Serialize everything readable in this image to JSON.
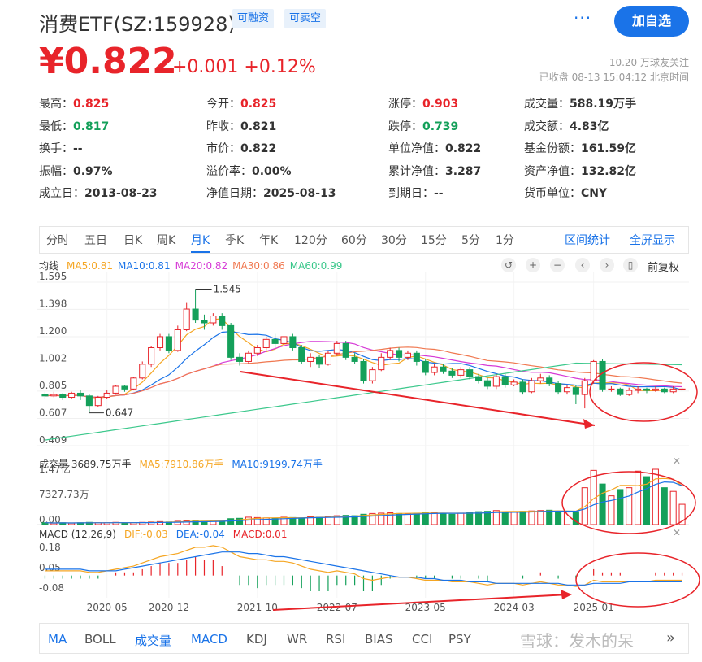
{
  "header": {
    "title": "消费ETF(SZ:159928)",
    "tags": [
      "可融资",
      "可卖空"
    ],
    "more_icon": "···",
    "follow_button": "加自选",
    "price": "¥0.822",
    "change": "+0.001 +0.12%",
    "followers": "10.20 万球友关注",
    "status_time": "已收盘 08-13 15:04:12 北京时间"
  },
  "quote": {
    "col1": [
      {
        "label": "最高：",
        "value": "0.825",
        "color": "red"
      },
      {
        "label": "最低：",
        "value": "0.817",
        "color": "green"
      },
      {
        "label": "换手：",
        "value": "--",
        "color": ""
      },
      {
        "label": "振幅：",
        "value": "0.97%",
        "color": ""
      },
      {
        "label": "成立日：",
        "value": "2013-08-23",
        "color": ""
      }
    ],
    "col2": [
      {
        "label": "今开：",
        "value": "0.825",
        "color": "red"
      },
      {
        "label": "昨收：",
        "value": "0.821",
        "color": ""
      },
      {
        "label": "市价：",
        "value": "0.822",
        "color": ""
      },
      {
        "label": "溢价率：",
        "value": "0.00%",
        "color": ""
      },
      {
        "label": "净值日期：",
        "value": "2025-08-13",
        "color": ""
      }
    ],
    "col3": [
      {
        "label": "涨停：",
        "value": "0.903",
        "color": "red"
      },
      {
        "label": "跌停：",
        "value": "0.739",
        "color": "green"
      },
      {
        "label": "单位净值：",
        "value": "0.822",
        "color": ""
      },
      {
        "label": "累计净值：",
        "value": "3.287",
        "color": ""
      },
      {
        "label": "到期日：",
        "value": "--",
        "color": ""
      }
    ],
    "col4": [
      {
        "label": "成交量：",
        "value": "588.19万手",
        "color": ""
      },
      {
        "label": "成交额：",
        "value": "4.83亿",
        "color": ""
      },
      {
        "label": "基金份额：",
        "value": "161.59亿",
        "color": ""
      },
      {
        "label": "资产净值：",
        "value": "132.82亿",
        "color": ""
      },
      {
        "label": "货币单位：",
        "value": "CNY",
        "color": ""
      }
    ]
  },
  "period_tabs": [
    "分时",
    "五日",
    "日K",
    "周K",
    "月K",
    "季K",
    "年K",
    "120分",
    "60分",
    "30分",
    "15分",
    "5分",
    "1分"
  ],
  "active_period": "月K",
  "tab_links": [
    "区间统计",
    "全屏显示"
  ],
  "ma_legend": {
    "label": "均线",
    "items": [
      {
        "text": "MA5:0.81",
        "color": "#f5a623"
      },
      {
        "text": "MA10:0.81",
        "color": "#1a73e8"
      },
      {
        "text": "MA20:0.82",
        "color": "#d63ad6"
      },
      {
        "text": "MA30:0.86",
        "color": "#f07850"
      },
      {
        "text": "MA60:0.99",
        "color": "#3cc88c"
      }
    ],
    "adjust": "前复权"
  },
  "controls": [
    "↺",
    "+",
    "−",
    "‹",
    "›",
    "▯"
  ],
  "vol_legend": {
    "label": "成交量 3689.75万手",
    "items": [
      {
        "text": "MA5:7910.86万手",
        "color": "#f5a623"
      },
      {
        "text": "MA10:9199.74万手",
        "color": "#1a73e8"
      }
    ]
  },
  "macd_legend": {
    "label": "MACD (12,26,9)",
    "items": [
      {
        "text": "DIF:-0.03",
        "color": "#f5a623"
      },
      {
        "text": "DEA:-0.04",
        "color": "#1a73e8"
      },
      {
        "text": "MACD:0.01",
        "color": "#e8242a"
      }
    ]
  },
  "indicators": [
    "MA",
    "BOLL",
    "成交量",
    "MACD",
    "KDJ",
    "WR",
    "RSI",
    "BIAS",
    "CCI",
    "PSY"
  ],
  "active_indicators": [
    "MA",
    "成交量",
    "MACD"
  ],
  "watermark": "雪球：发木的呆",
  "chart_data": {
    "type": "candlestick",
    "price_ticks": [
      "1.595",
      "1.398",
      "1.200",
      "1.002",
      "0.805",
      "0.607",
      "0.409"
    ],
    "price_ylim": [
      0.409,
      1.595
    ],
    "max_label": "1.545",
    "min_label": "0.647",
    "vol_ticks": [
      "1.47亿",
      "7327.73万",
      "0.00"
    ],
    "macd_ticks": [
      "0.18",
      "0.05",
      "-0.08"
    ],
    "x_ticks": [
      "2020-05",
      "2020-12",
      "2021-10",
      "2022-07",
      "2023-05",
      "2024-03",
      "2025-01"
    ],
    "candles": [
      [
        0.78,
        0.77,
        0.8,
        0.75
      ],
      [
        0.77,
        0.78,
        0.8,
        0.76
      ],
      [
        0.78,
        0.76,
        0.79,
        0.74
      ],
      [
        0.76,
        0.79,
        0.8,
        0.75
      ],
      [
        0.79,
        0.77,
        0.81,
        0.74
      ],
      [
        0.77,
        0.7,
        0.78,
        0.65
      ],
      [
        0.7,
        0.76,
        0.77,
        0.69
      ],
      [
        0.76,
        0.79,
        0.81,
        0.75
      ],
      [
        0.79,
        0.84,
        0.85,
        0.78
      ],
      [
        0.84,
        0.82,
        0.85,
        0.8
      ],
      [
        0.82,
        0.9,
        0.91,
        0.81
      ],
      [
        0.9,
        1.0,
        1.02,
        0.89
      ],
      [
        1.0,
        1.12,
        1.13,
        0.98
      ],
      [
        1.12,
        1.2,
        1.22,
        1.1
      ],
      [
        1.2,
        1.1,
        1.22,
        1.08
      ],
      [
        1.1,
        1.25,
        1.28,
        1.09
      ],
      [
        1.25,
        1.4,
        1.45,
        1.24
      ],
      [
        1.4,
        1.32,
        1.545,
        1.3
      ],
      [
        1.32,
        1.3,
        1.36,
        1.25
      ],
      [
        1.3,
        1.35,
        1.37,
        1.28
      ],
      [
        1.35,
        1.28,
        1.37,
        1.25
      ],
      [
        1.28,
        1.05,
        1.3,
        1.03
      ],
      [
        1.05,
        1.02,
        1.08,
        0.99
      ],
      [
        1.02,
        1.08,
        1.1,
        1.0
      ],
      [
        1.08,
        1.12,
        1.14,
        1.06
      ],
      [
        1.12,
        1.18,
        1.2,
        1.1
      ],
      [
        1.18,
        1.15,
        1.22,
        1.12
      ],
      [
        1.15,
        1.2,
        1.24,
        1.13
      ],
      [
        1.2,
        1.12,
        1.22,
        1.1
      ],
      [
        1.12,
        1.02,
        1.14,
        1.0
      ],
      [
        1.02,
        1.05,
        1.08,
        0.98
      ],
      [
        1.05,
        1.0,
        1.07,
        0.97
      ],
      [
        1.0,
        1.08,
        1.1,
        0.99
      ],
      [
        1.08,
        1.15,
        1.17,
        1.06
      ],
      [
        1.15,
        1.05,
        1.17,
        1.03
      ],
      [
        1.05,
        1.02,
        1.08,
        1.0
      ],
      [
        1.02,
        0.88,
        1.04,
        0.86
      ],
      [
        0.88,
        0.96,
        0.98,
        0.86
      ],
      [
        0.96,
        1.05,
        1.08,
        0.95
      ],
      [
        1.05,
        1.1,
        1.12,
        1.03
      ],
      [
        1.1,
        1.05,
        1.12,
        1.02
      ],
      [
        1.05,
        1.08,
        1.1,
        1.03
      ],
      [
        1.08,
        1.02,
        1.1,
        0.99
      ],
      [
        1.02,
        0.94,
        1.04,
        0.92
      ],
      [
        0.94,
        0.98,
        1.0,
        0.92
      ],
      [
        0.98,
        0.95,
        1.0,
        0.93
      ],
      [
        0.95,
        0.92,
        0.97,
        0.9
      ],
      [
        0.92,
        0.96,
        0.98,
        0.9
      ],
      [
        0.96,
        0.91,
        0.98,
        0.89
      ],
      [
        0.91,
        0.88,
        0.93,
        0.86
      ],
      [
        0.88,
        0.84,
        0.9,
        0.82
      ],
      [
        0.84,
        0.91,
        0.93,
        0.82
      ],
      [
        0.91,
        0.85,
        0.93,
        0.83
      ],
      [
        0.85,
        0.87,
        0.89,
        0.84
      ],
      [
        0.87,
        0.8,
        0.89,
        0.78
      ],
      [
        0.8,
        0.88,
        0.9,
        0.79
      ],
      [
        0.88,
        0.9,
        0.93,
        0.86
      ],
      [
        0.9,
        0.86,
        0.92,
        0.84
      ],
      [
        0.86,
        0.8,
        0.88,
        0.78
      ],
      [
        0.8,
        0.83,
        0.85,
        0.78
      ],
      [
        0.83,
        0.78,
        0.85,
        0.71
      ],
      [
        0.78,
        0.88,
        0.9,
        0.68
      ],
      [
        0.88,
        1.02,
        1.03,
        0.86
      ],
      [
        1.02,
        0.82,
        1.04,
        0.8
      ],
      [
        0.82,
        0.82,
        0.84,
        0.8
      ],
      [
        0.82,
        0.78,
        0.83,
        0.77
      ],
      [
        0.78,
        0.81,
        0.83,
        0.77
      ],
      [
        0.81,
        0.82,
        0.84,
        0.79
      ],
      [
        0.82,
        0.81,
        0.83,
        0.79
      ],
      [
        0.81,
        0.82,
        0.84,
        0.8
      ],
      [
        0.82,
        0.8,
        0.83,
        0.79
      ],
      [
        0.8,
        0.82,
        0.84,
        0.79
      ],
      [
        0.82,
        0.82,
        0.83,
        0.81
      ]
    ],
    "volumes": [
      0.05,
      0.04,
      0.05,
      0.04,
      0.05,
      0.06,
      0.05,
      0.05,
      0.06,
      0.05,
      0.05,
      0.06,
      0.07,
      0.08,
      0.07,
      0.09,
      0.1,
      0.11,
      0.09,
      0.1,
      0.12,
      0.16,
      0.17,
      0.2,
      0.19,
      0.18,
      0.17,
      0.2,
      0.19,
      0.18,
      0.21,
      0.2,
      0.22,
      0.24,
      0.25,
      0.24,
      0.28,
      0.3,
      0.31,
      0.32,
      0.3,
      0.29,
      0.31,
      0.33,
      0.32,
      0.3,
      0.28,
      0.31,
      0.33,
      0.35,
      0.36,
      0.38,
      0.35,
      0.34,
      0.36,
      0.37,
      0.38,
      0.39,
      0.36,
      0.34,
      0.35,
      1.0,
      1.47,
      1.1,
      0.78,
      0.95,
      1.0,
      1.45,
      1.3,
      1.5,
      1.0,
      0.9,
      0.55
    ],
    "macd_dif": [
      0.03,
      0.03,
      0.03,
      0.03,
      0.03,
      0.02,
      0.02,
      0.03,
      0.04,
      0.05,
      0.06,
      0.08,
      0.1,
      0.12,
      0.13,
      0.14,
      0.16,
      0.18,
      0.18,
      0.19,
      0.18,
      0.15,
      0.12,
      0.11,
      0.1,
      0.1,
      0.09,
      0.09,
      0.08,
      0.06,
      0.04,
      0.03,
      0.02,
      0.03,
      0.02,
      0.01,
      -0.02,
      -0.03,
      -0.02,
      -0.01,
      -0.01,
      -0.01,
      -0.02,
      -0.03,
      -0.03,
      -0.03,
      -0.04,
      -0.04,
      -0.04,
      -0.05,
      -0.06,
      -0.05,
      -0.05,
      -0.05,
      -0.06,
      -0.05,
      -0.04,
      -0.05,
      -0.06,
      -0.06,
      -0.07,
      -0.06,
      -0.03,
      -0.04,
      -0.04,
      -0.04,
      -0.04,
      -0.04,
      -0.04,
      -0.03,
      -0.03,
      -0.03,
      -0.03
    ],
    "macd_dea": [
      0.04,
      0.04,
      0.04,
      0.04,
      0.04,
      0.03,
      0.03,
      0.03,
      0.03,
      0.04,
      0.05,
      0.06,
      0.07,
      0.08,
      0.09,
      0.1,
      0.11,
      0.12,
      0.13,
      0.14,
      0.15,
      0.15,
      0.15,
      0.14,
      0.14,
      0.13,
      0.12,
      0.12,
      0.11,
      0.1,
      0.09,
      0.08,
      0.07,
      0.06,
      0.05,
      0.04,
      0.03,
      0.02,
      0.01,
      0.0,
      -0.01,
      -0.01,
      -0.01,
      -0.02,
      -0.02,
      -0.03,
      -0.03,
      -0.03,
      -0.04,
      -0.04,
      -0.04,
      -0.05,
      -0.05,
      -0.05,
      -0.05,
      -0.05,
      -0.05,
      -0.05,
      -0.05,
      -0.06,
      -0.06,
      -0.06,
      -0.05,
      -0.05,
      -0.05,
      -0.05,
      -0.04,
      -0.04,
      -0.04,
      -0.04,
      -0.04,
      -0.04,
      -0.04
    ]
  }
}
